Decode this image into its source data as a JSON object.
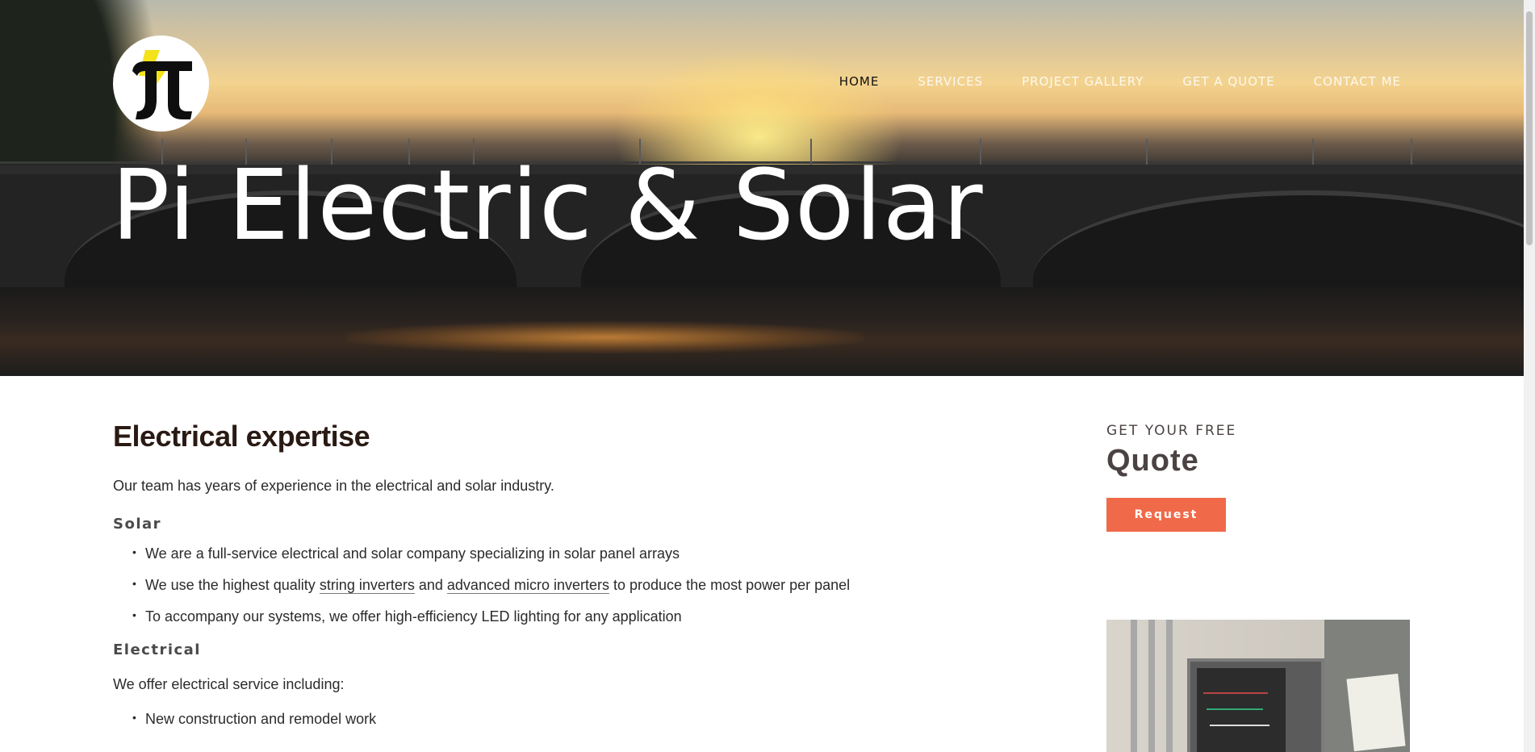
{
  "nav": {
    "items": [
      {
        "label": "HOME",
        "active": true
      },
      {
        "label": "SERVICES",
        "active": false
      },
      {
        "label": "PROJECT GALLERY",
        "active": false
      },
      {
        "label": "GET A QUOTE",
        "active": false
      },
      {
        "label": "CONTACT ME",
        "active": false
      }
    ]
  },
  "hero": {
    "title": "Pi Electric & Solar"
  },
  "main": {
    "heading": "Electrical expertise",
    "intro": "Our team has years of experience in the electrical and solar industry.",
    "solar_heading": "Solar",
    "solar_items": [
      "We are a full-service electrical and solar company specializing in solar panel arrays",
      "To accompany our systems, we offer high-efficiency LED lighting for any application"
    ],
    "solar_item2": {
      "before": "We use the highest quality ",
      "link1": "string inverters",
      "middle": " and ",
      "link2": "advanced micro inverters",
      "after": " to produce the most power per panel"
    },
    "electrical_heading": "Electrical",
    "electrical_intro": "We offer electrical service including:",
    "electrical_items": [
      "New construction and remodel work"
    ]
  },
  "sidebar": {
    "kicker": "GET YOUR FREE",
    "title": "Quote",
    "button_label": "Request"
  },
  "colors": {
    "accent": "#f06a4a",
    "heading": "#2a1a14"
  }
}
